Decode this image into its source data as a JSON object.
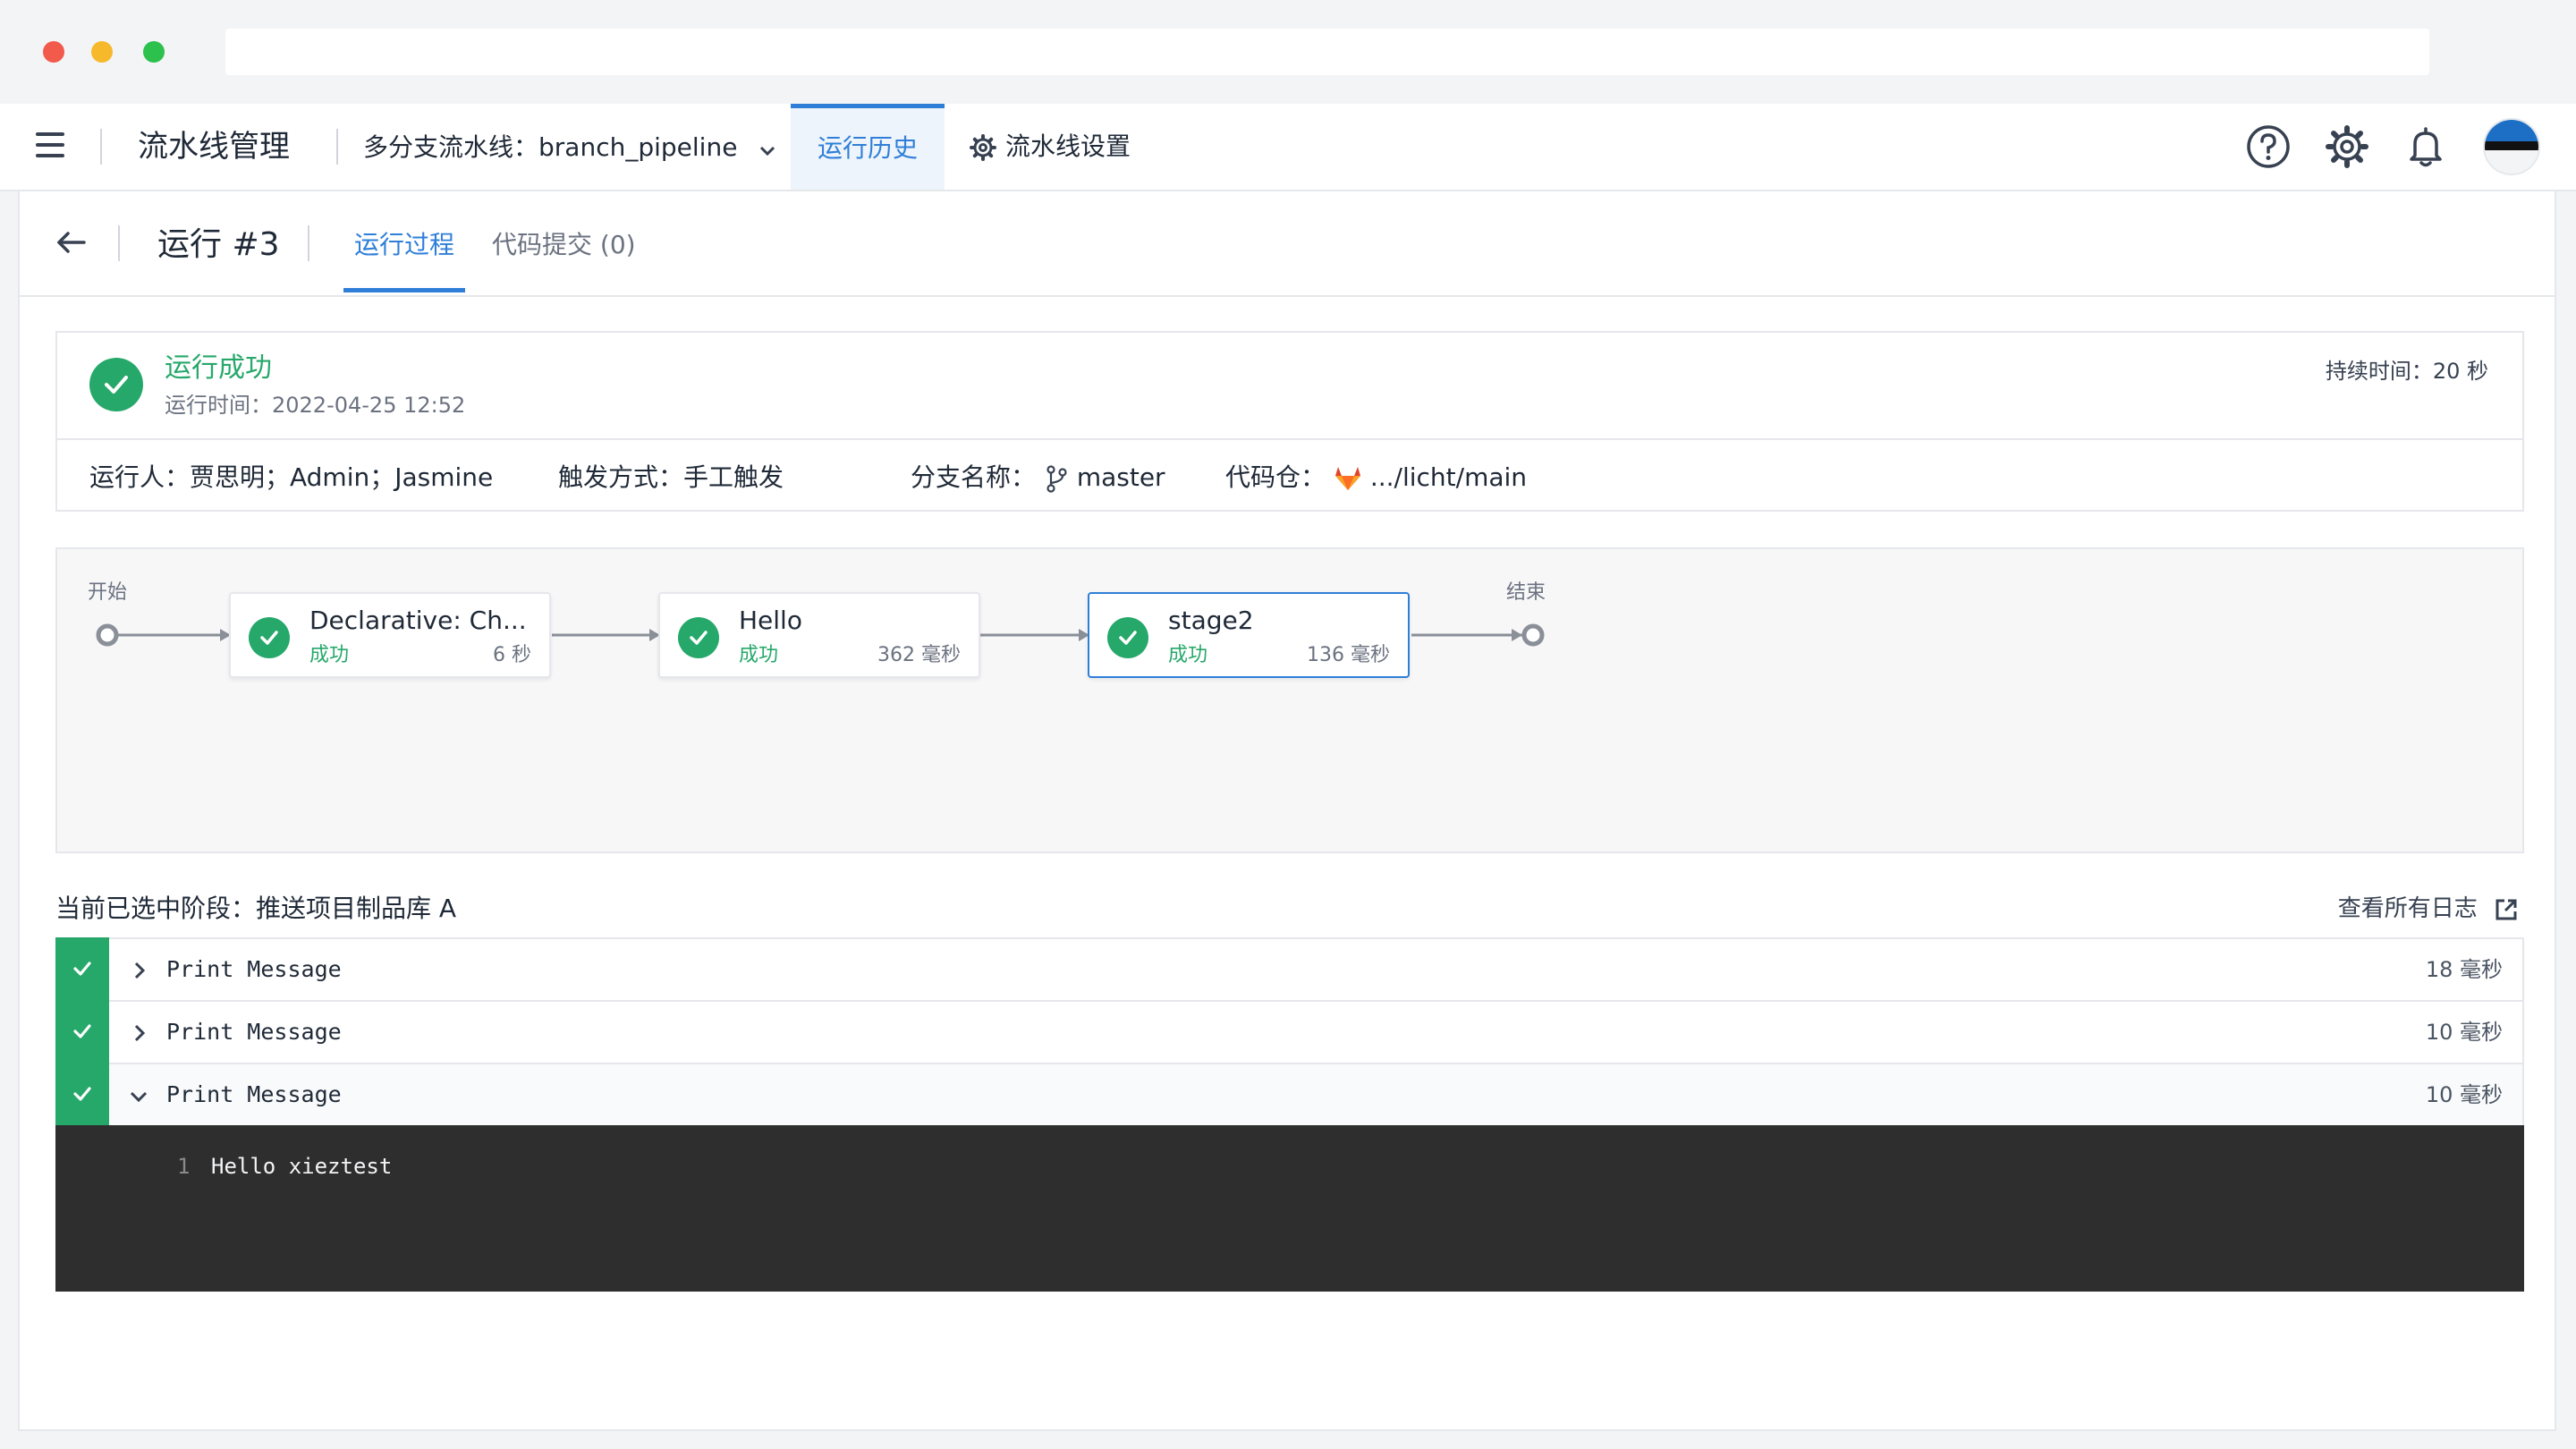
{
  "colors": {
    "accent": "#2f7fd8",
    "success": "#26a86a",
    "console_bg": "#2e2e2e",
    "gitlab": "#e24329"
  },
  "topnav": {
    "title": "流水线管理",
    "pipeline_select": "多分支流水线：branch_pipeline",
    "tabs": [
      {
        "label": "运行历史",
        "active": true
      },
      {
        "label": "流水线设置",
        "icon": "gear-icon",
        "active": false
      }
    ],
    "icons": [
      "help-icon",
      "settings-icon",
      "bell-icon"
    ]
  },
  "run": {
    "title": "运行 #3",
    "tabs": [
      {
        "label": "运行过程",
        "active": true
      },
      {
        "label": "代码提交 (0)",
        "active": false
      }
    ]
  },
  "status": {
    "title": "运行成功",
    "time": "运行时间：2022-04-25 12:52",
    "duration": "持续时间：20 秒",
    "runner": "运行人：贾思明；Admin；Jasmine",
    "trigger": "触发方式：手工触发",
    "branch_label": "分支名称：",
    "branch": "master",
    "repo_label": "代码仓：",
    "repo": ".../licht/main"
  },
  "graph": {
    "start_label": "开始",
    "end_label": "结束",
    "stages": [
      {
        "name": "Declarative: Ch...",
        "status": "成功",
        "duration": "6 秒",
        "selected": false
      },
      {
        "name": "Hello",
        "status": "成功",
        "duration": "362 毫秒",
        "selected": false
      },
      {
        "name": "stage2",
        "status": "成功",
        "duration": "136 毫秒",
        "selected": true
      }
    ]
  },
  "logs": {
    "selected_label": "当前已选中阶段：推送项目制品库 A",
    "view_all": "查看所有日志",
    "steps": [
      {
        "name": "Print Message",
        "duration": "18 毫秒",
        "expanded": false
      },
      {
        "name": "Print Message",
        "duration": "10 毫秒",
        "expanded": false
      },
      {
        "name": "Print Message",
        "duration": "10 毫秒",
        "expanded": true
      }
    ],
    "console": [
      {
        "line": "1",
        "text": "Hello xieztest"
      }
    ]
  }
}
